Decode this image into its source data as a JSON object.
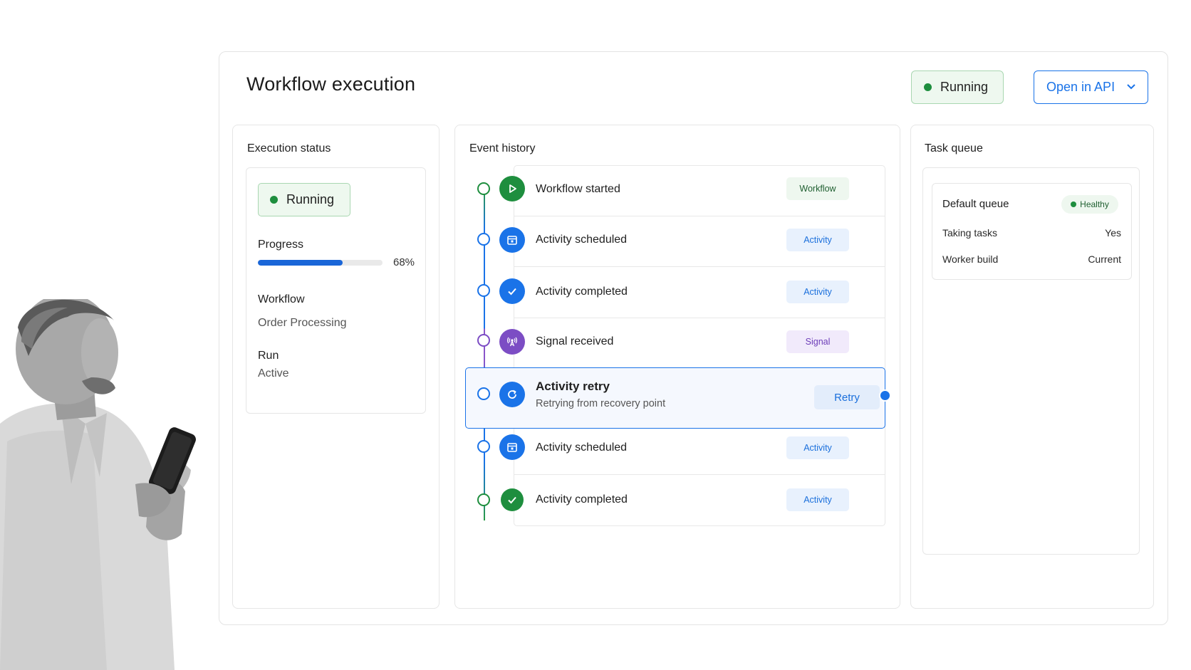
{
  "header": {
    "title": "Workflow execution",
    "status_label": "Running",
    "api_button_label": "Open in API"
  },
  "colors": {
    "accent": "#1a73e8",
    "success": "#1e8e3e",
    "signal": "#7c4dc4"
  },
  "execution_status": {
    "title": "Execution status",
    "status_label": "Running",
    "progress_label": "Progress",
    "progress_value": 0.68,
    "progress_text": "68%",
    "workflow_label": "Workflow",
    "workflow_value": "Order Processing",
    "run_label": "Run",
    "run_value": "Active"
  },
  "event_history": {
    "title": "Event history",
    "events": [
      {
        "label": "Workflow started",
        "tag": "Workflow",
        "icon": "play-icon"
      },
      {
        "label": "Activity scheduled",
        "tag": "Activity",
        "icon": "calendar-icon"
      },
      {
        "label": "Activity completed",
        "tag": "Activity",
        "icon": "check-icon"
      },
      {
        "label": "Signal received",
        "tag": "Signal",
        "icon": "signal-icon"
      },
      {
        "label": "Activity retry",
        "sublabel": "Retrying from recovery point",
        "tag": "Retry",
        "icon": "refresh-icon"
      },
      {
        "label": "Activity scheduled",
        "tag": "Activity",
        "icon": "calendar-icon"
      },
      {
        "label": "Activity completed",
        "tag": "Activity",
        "icon": "check-icon"
      }
    ]
  },
  "task_queue": {
    "title": "Task queue",
    "queue_name": "Default queue",
    "health": "Healthy",
    "rows": [
      {
        "key": "Taking tasks",
        "value": "Yes"
      },
      {
        "key": "Worker build",
        "value": "Current"
      }
    ]
  }
}
